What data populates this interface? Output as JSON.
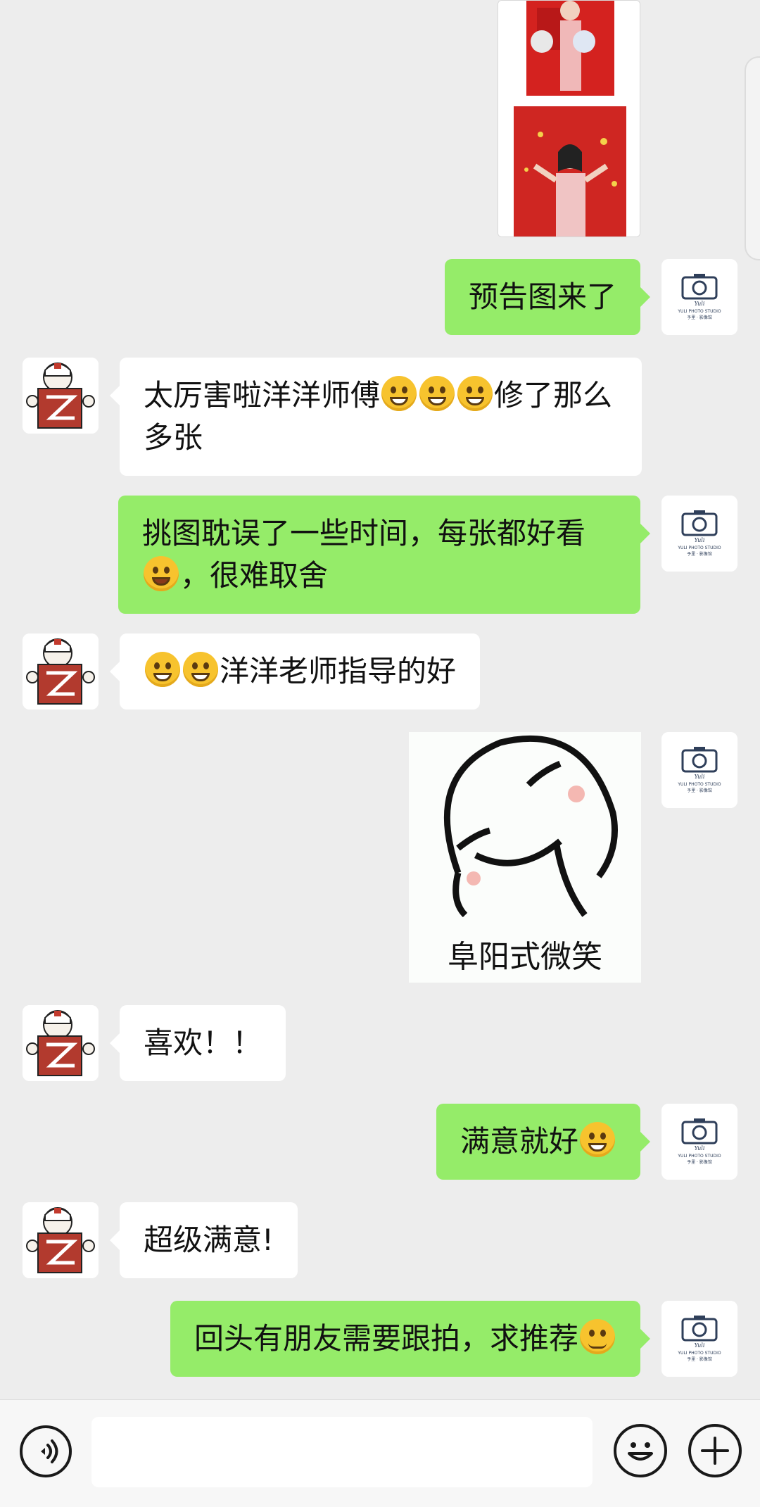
{
  "messages": [
    {
      "side": "right",
      "type": "image",
      "desc_name": "forecast-photo"
    },
    {
      "side": "right",
      "type": "text",
      "text": "预告图来了"
    },
    {
      "side": "left",
      "type": "text",
      "text_a": "太厉害啦洋洋师傅",
      "text_b": "修了那么多张"
    },
    {
      "side": "right",
      "type": "text",
      "text_a": "挑图耽误了一些时间，每张都好看",
      "text_b": "，很难取舍"
    },
    {
      "side": "left",
      "type": "text",
      "text": "洋洋老师指导的好"
    },
    {
      "side": "right",
      "type": "sticker",
      "caption": "阜阳式微笑"
    },
    {
      "side": "left",
      "type": "text",
      "text": "喜欢！！"
    },
    {
      "side": "right",
      "type": "text",
      "text": "满意就好"
    },
    {
      "side": "left",
      "type": "text",
      "text": "超级满意!"
    },
    {
      "side": "right",
      "type": "text",
      "text": "回头有朋友需要跟拍，求推荐"
    }
  ],
  "studio_avatar": {
    "line1": "YULI PHOTO STUDIO",
    "line2": "予里 · 影像馆",
    "script": "Yuli"
  },
  "input_bar": {
    "voice_icon": "voice-icon",
    "emoji_icon": "emoji-icon",
    "plus_icon": "plus-icon",
    "placeholder": ""
  },
  "colors": {
    "background": "#ededed",
    "self_bubble": "#95ec69",
    "other_bubble": "#ffffff",
    "poster_red": "#d4221f"
  }
}
